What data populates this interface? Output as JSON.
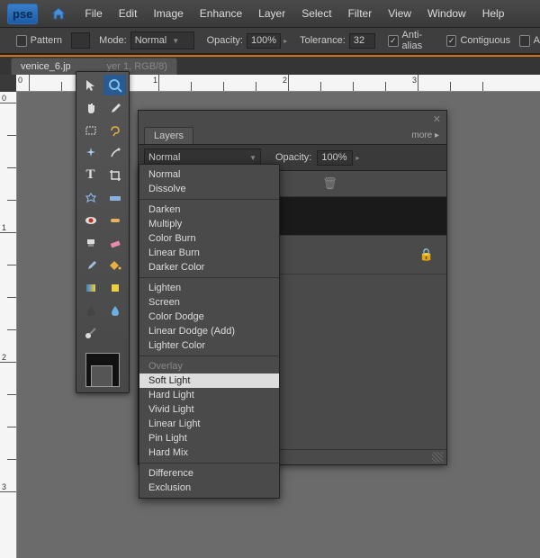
{
  "menu": {
    "items": [
      "File",
      "Edit",
      "Image",
      "Enhance",
      "Layer",
      "Select",
      "Filter",
      "View",
      "Window",
      "Help"
    ]
  },
  "optbar": {
    "pattern": "Pattern",
    "mode": "Mode:",
    "mode_val": "Normal",
    "opacity": "Opacity:",
    "opacity_val": "100%",
    "tolerance": "Tolerance:",
    "tolerance_val": "32",
    "anti": "Anti-alias",
    "contig": "Contiguous",
    "all": "A"
  },
  "tab": {
    "name": "venice_6.jp",
    "meta": "yer 1, RGB/8)"
  },
  "layers": {
    "title": "Layers",
    "more": "more ▸",
    "blend": "Normal",
    "opacity": "Opacity:",
    "opacity_val": "100%"
  },
  "blend_modes": {
    "g1": [
      "Normal",
      "Dissolve"
    ],
    "g2": [
      "Darken",
      "Multiply",
      "Color Burn",
      "Linear Burn",
      "Darker Color"
    ],
    "g3": [
      "Lighten",
      "Screen",
      "Color Dodge",
      "Linear Dodge (Add)",
      "Lighter Color"
    ],
    "g4": [
      "Overlay",
      "Soft Light",
      "Hard Light",
      "Vivid Light",
      "Linear Light",
      "Pin Light",
      "Hard Mix"
    ],
    "g5": [
      "Difference",
      "Exclusion"
    ]
  },
  "ruler_h": [
    "0",
    "1",
    "2",
    "3"
  ],
  "ruler_v": [
    "0",
    "1",
    "2",
    "3"
  ]
}
